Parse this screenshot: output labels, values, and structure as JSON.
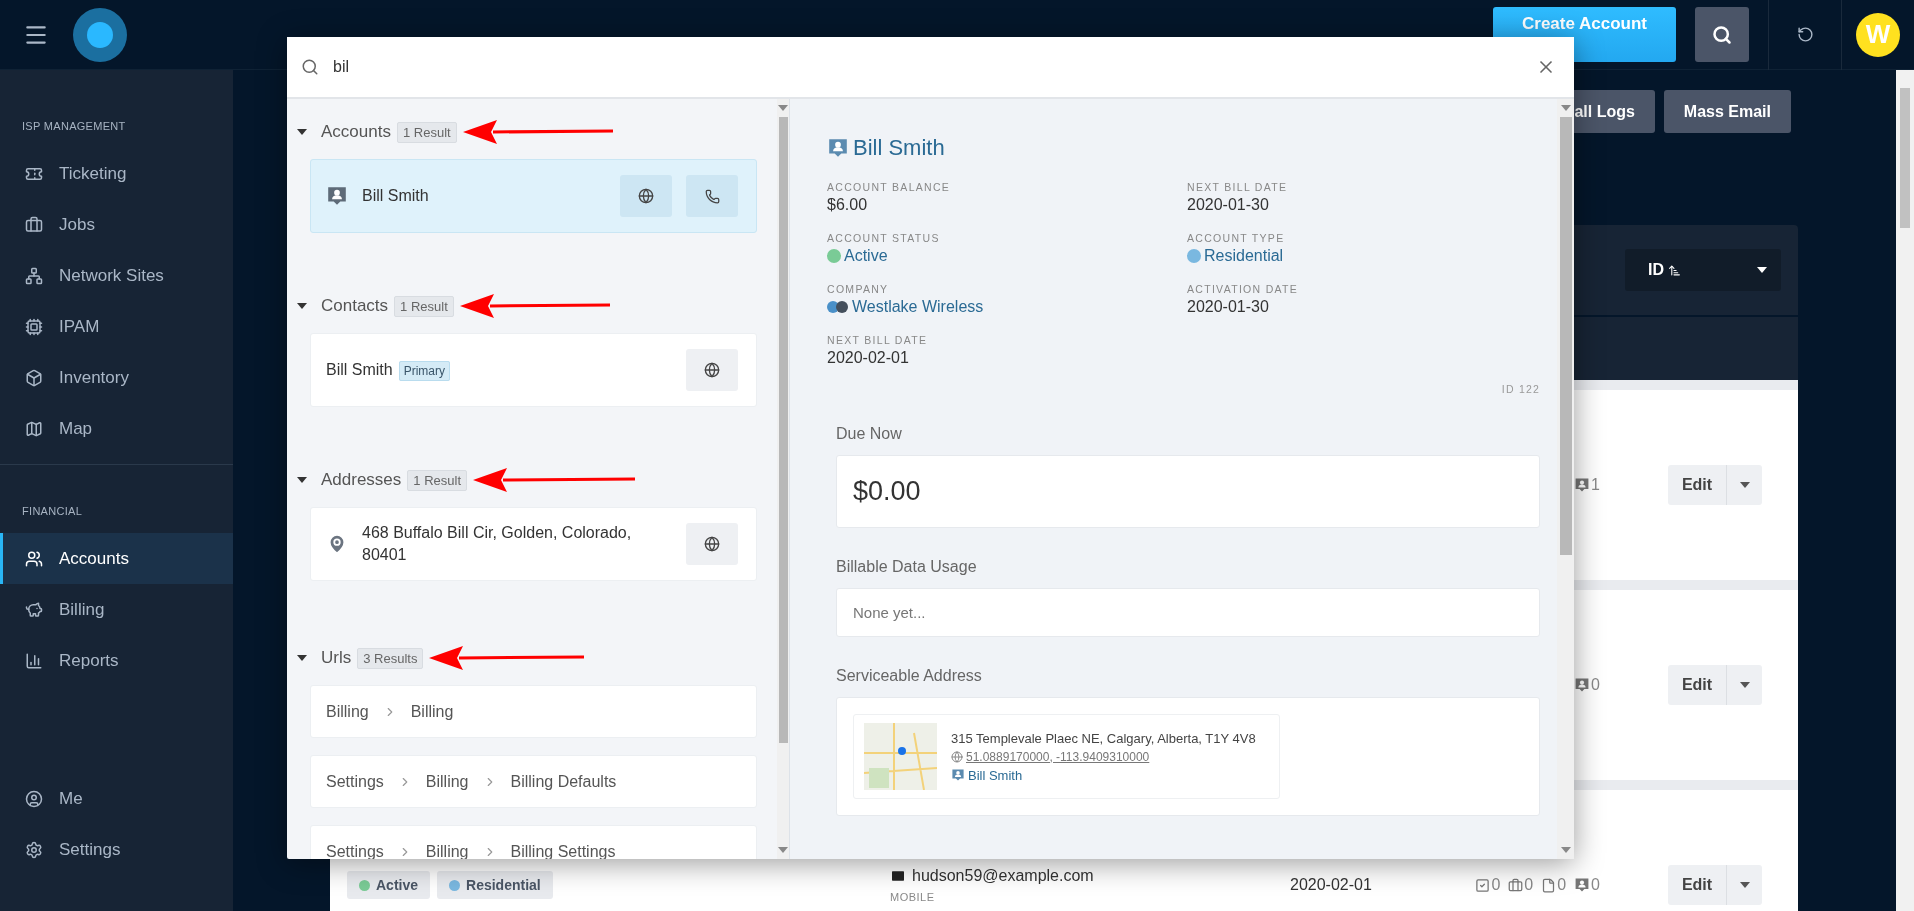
{
  "topbar": {
    "create_button": "Create Account",
    "avatar": "W"
  },
  "sidebar": {
    "sections": [
      {
        "heading": "ISP MANAGEMENT",
        "items": [
          {
            "label": "Ticketing",
            "kind": "ticket",
            "selected": false
          },
          {
            "label": "Jobs",
            "kind": "briefcase",
            "selected": false
          },
          {
            "label": "Network Sites",
            "kind": "network",
            "selected": false
          },
          {
            "label": "IPAM",
            "kind": "ipam",
            "selected": false
          },
          {
            "label": "Inventory",
            "kind": "box",
            "selected": false
          },
          {
            "label": "Map",
            "kind": "map",
            "selected": false
          }
        ]
      },
      {
        "heading": "FINANCIAL",
        "items": [
          {
            "label": "Accounts",
            "kind": "users",
            "selected": true
          },
          {
            "label": "Billing",
            "kind": "piggy",
            "selected": false
          },
          {
            "label": "Reports",
            "kind": "chart",
            "selected": false
          }
        ]
      }
    ],
    "bottom_items": [
      {
        "label": "Me",
        "kind": "user",
        "selected": false
      },
      {
        "label": "Settings",
        "kind": "gear",
        "selected": false
      }
    ]
  },
  "page": {
    "buttons": [
      "all Logs",
      "Mass Email"
    ],
    "sort": {
      "value": "ID"
    },
    "rows": [
      {
        "counts": [
          {
            "kind": "tickets",
            "value": "1"
          }
        ],
        "edit": "Edit"
      },
      {
        "counts": [
          {
            "kind": "tickets",
            "value": "0"
          }
        ],
        "edit": "Edit"
      },
      {
        "badges": [
          {
            "label": "Active",
            "color": "#7acb96"
          },
          {
            "label": "Residential",
            "color": "#7ab8e0"
          }
        ],
        "email": "hudson59@example.com",
        "mobile_label": "MOBILE",
        "date": "2020-02-01",
        "counts": [
          {
            "kind": "tasks",
            "value": "0"
          },
          {
            "kind": "jobs",
            "value": "0"
          },
          {
            "kind": "docs",
            "value": "0"
          },
          {
            "kind": "tickets",
            "value": "0"
          }
        ],
        "edit": "Edit"
      }
    ]
  },
  "search": {
    "query": "bil",
    "sections": [
      {
        "kind": "accounts",
        "title": "Accounts",
        "count": "1 Result",
        "arrow": true,
        "results": [
          {
            "name": "Bill Smith",
            "selected": true
          }
        ]
      },
      {
        "kind": "contacts",
        "title": "Contacts",
        "count": "1 Result",
        "arrow": true,
        "results": [
          {
            "name": "Bill Smith",
            "tag": "Primary"
          }
        ]
      },
      {
        "kind": "addresses",
        "title": "Addresses",
        "count": "1 Result",
        "arrow": true,
        "results": [
          {
            "text": "468 Buffalo Bill Cir, Golden, Colorado, 80401"
          }
        ]
      },
      {
        "kind": "urls",
        "title": "Urls",
        "count": "3 Results",
        "arrow": true,
        "results": [
          {
            "path": [
              "Billing",
              "Billing"
            ]
          },
          {
            "path": [
              "Settings",
              "Billing",
              "Billing Defaults"
            ]
          },
          {
            "path": [
              "Settings",
              "Billing",
              "Billing Settings"
            ]
          }
        ]
      }
    ]
  },
  "detail": {
    "name": "Bill Smith",
    "fields": [
      {
        "label": "ACCOUNT BALANCE",
        "value": "$6.00",
        "kind": "plain"
      },
      {
        "label": "NEXT BILL DATE",
        "value": "2020-01-30",
        "kind": "plain"
      },
      {
        "label": "ACCOUNT STATUS",
        "value": "Active",
        "kind": "dot",
        "color": "#7acb96"
      },
      {
        "label": "ACCOUNT TYPE",
        "value": "Residential",
        "kind": "dot",
        "color": "#7ab8e0"
      },
      {
        "label": "COMPANY",
        "value": "Westlake Wireless",
        "kind": "company"
      },
      {
        "label": "ACTIVATION DATE",
        "value": "2020-01-30",
        "kind": "plain"
      },
      {
        "label": "NEXT BILL DATE",
        "value": "2020-02-01",
        "kind": "plain"
      }
    ],
    "id": "ID 122",
    "due_now": {
      "label": "Due Now",
      "value": "$0.00"
    },
    "usage": {
      "label": "Billable Data Usage",
      "value": "None yet..."
    },
    "address": {
      "label": "Serviceable Address",
      "line": "315 Templevale Plaec NE, Calgary, Alberta, T1Y 4V8",
      "coords": "51.0889170000, -113.9409310000",
      "contact": "Bill Smith"
    }
  }
}
